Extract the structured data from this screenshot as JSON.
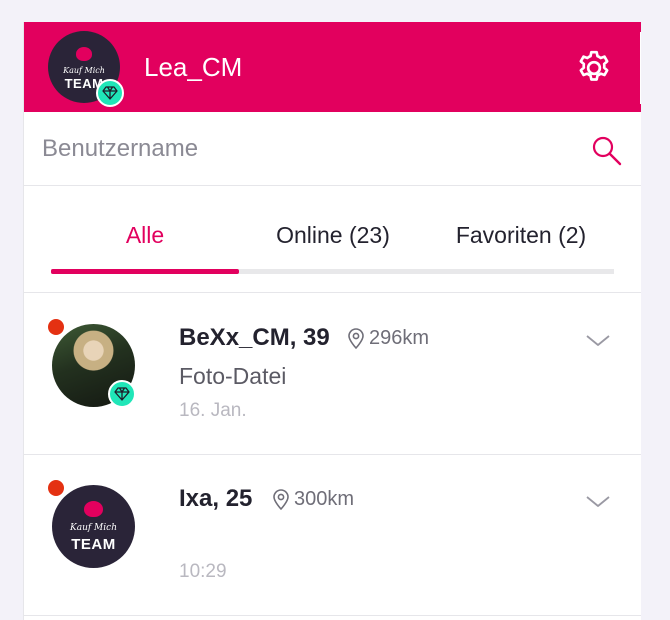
{
  "colors": {
    "brand": "#e2005e",
    "online": "#e43112",
    "badge": "#20e6b8"
  },
  "header": {
    "username": "Lea_CM",
    "avatar_logo": {
      "script": "Kauf Mich",
      "team": "TEAM"
    },
    "avatar_badge_icon": "diamond-icon",
    "settings_icon": "gear-icon"
  },
  "search": {
    "placeholder": "Benutzername",
    "value": "",
    "icon": "search-icon"
  },
  "tabs": [
    {
      "label": "Alle",
      "active": true
    },
    {
      "label": "Online (23)",
      "active": false
    },
    {
      "label": "Favoriten (2)",
      "active": false
    }
  ],
  "conversations": [
    {
      "name": "BeXx_CM, 39",
      "distance": "296km",
      "last_message": "Foto-Datei",
      "time": "16. Jan.",
      "online": true,
      "premium_badge": true,
      "avatar": "photo"
    },
    {
      "name": "Ixa, 25",
      "distance": "300km",
      "last_message": "",
      "time": "10:29",
      "online": true,
      "premium_badge": false,
      "avatar": "team-logo",
      "avatar_logo": {
        "script": "Kauf Mich",
        "team": "TEAM"
      }
    }
  ]
}
